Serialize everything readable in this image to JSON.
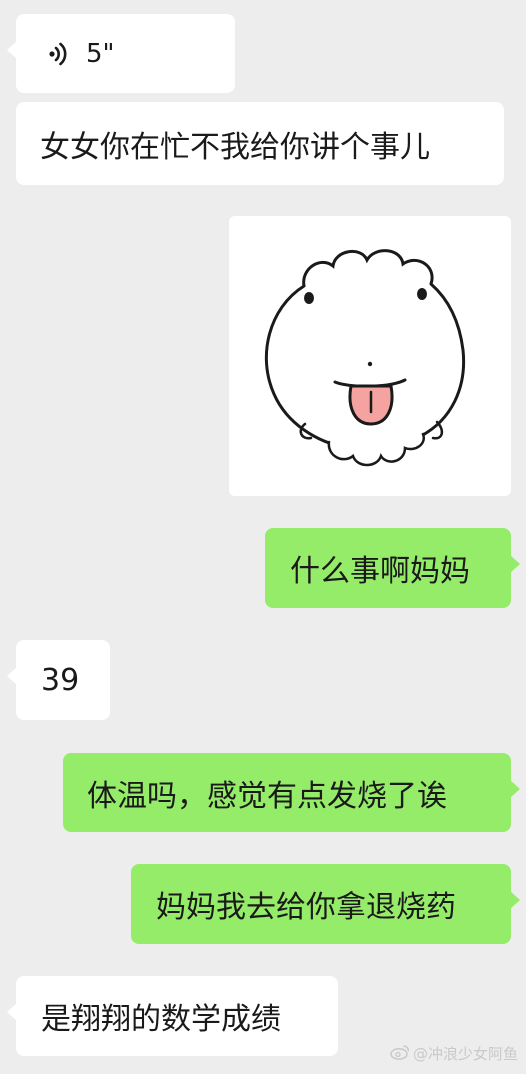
{
  "messages": [
    {
      "sender": "other",
      "type": "voice",
      "duration": "5\""
    },
    {
      "sender": "other",
      "type": "text",
      "text": "女女你在忙不我给你讲个事儿"
    },
    {
      "sender": "self",
      "type": "sticker",
      "sticker": "tongue-out-face-sticker"
    },
    {
      "sender": "self",
      "type": "text",
      "text": "什么事啊妈妈"
    },
    {
      "sender": "other",
      "type": "text",
      "text": "39"
    },
    {
      "sender": "self",
      "type": "text",
      "text": "体温吗，感觉有点发烧了诶"
    },
    {
      "sender": "self",
      "type": "text",
      "text": "妈妈我去给你拿退烧药"
    },
    {
      "sender": "other",
      "type": "text",
      "text": "是翔翔的数学成绩"
    }
  ],
  "watermark": {
    "icon": "weibo-icon",
    "text": "@冲浪少女阿鱼"
  },
  "colors": {
    "background": "#ededed",
    "incoming": "#ffffff",
    "outgoing": "#95ec69"
  }
}
